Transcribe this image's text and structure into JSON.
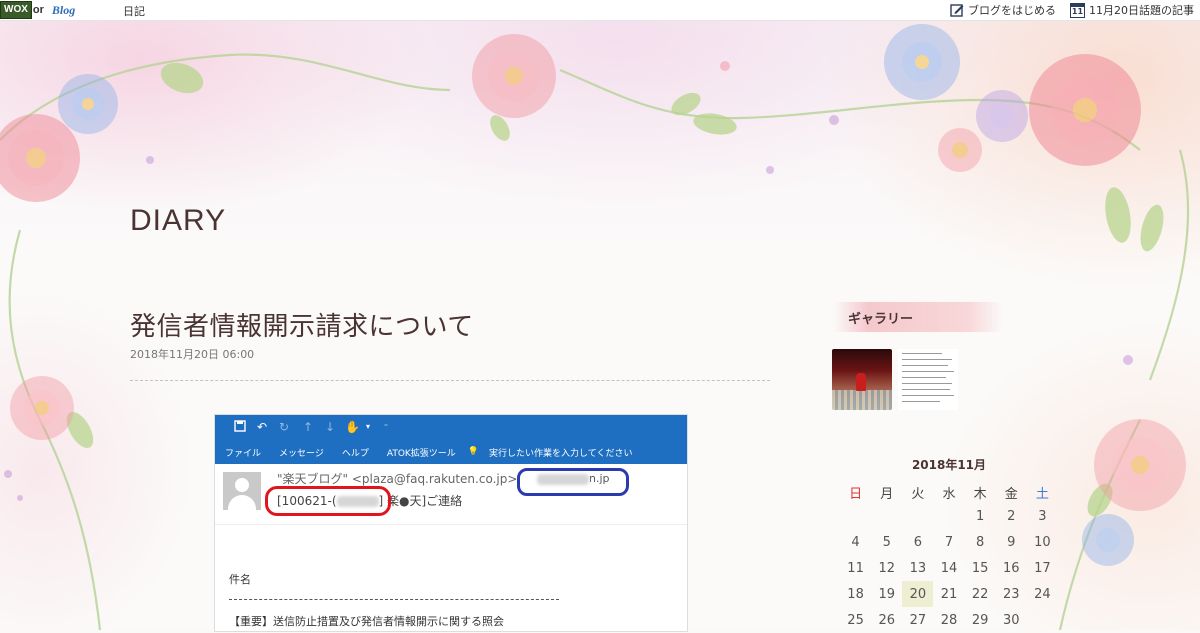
{
  "topbar": {
    "logo_text": "WOX",
    "logo_suffix": "or",
    "logo_blog": "Blog",
    "nav_diary": "日記",
    "start_blog": "ブログをはじめる",
    "calendar_icon_day": "11",
    "topic_link": "11月20日話題の記事"
  },
  "site": {
    "title": "DIARY"
  },
  "post": {
    "title": "発信者情報開示請求について",
    "date": "2018年11月20日 06:00"
  },
  "email_shot": {
    "menu": [
      "ファイル",
      "メッセージ",
      "ヘルプ",
      "ATOK拡張ツール"
    ],
    "search_hint": "実行したい作業を入力してください",
    "from": "\"楽天ブログ\" <plaza@faq.rakuten.co.jp>",
    "to_suffix": "n.jp",
    "subject_prefix": "[100621-(",
    "subject_suffix": "] 楽●天]ご連絡",
    "body_label": "件名",
    "body_text": "【重要】送信防止措置及び発信者情報開示に関する照会"
  },
  "sidebar": {
    "gallery_title": "ギャラリー"
  },
  "calendar": {
    "title": "2018年11月",
    "weekdays": [
      "日",
      "月",
      "火",
      "水",
      "木",
      "金",
      "土"
    ],
    "weeks": [
      [
        "",
        "",
        "",
        "",
        "1",
        "2",
        "3"
      ],
      [
        "4",
        "5",
        "6",
        "7",
        "8",
        "9",
        "10"
      ],
      [
        "11",
        "12",
        "13",
        "14",
        "15",
        "16",
        "17"
      ],
      [
        "18",
        "19",
        "20",
        "21",
        "22",
        "23",
        "24"
      ],
      [
        "25",
        "26",
        "27",
        "28",
        "29",
        "30",
        ""
      ]
    ],
    "today": "20"
  },
  "colors": {
    "ribbon_blue": "#1e6fc1",
    "annotation_red": "#e2141d",
    "annotation_blue": "#2c3ab0",
    "text_main": "#4a3433"
  }
}
